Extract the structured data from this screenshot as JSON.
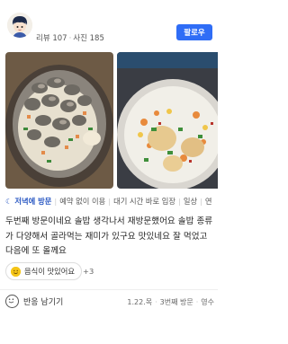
{
  "profile": {
    "stats_reviews": "리뷰 107",
    "stats_photos": "사진 185",
    "follow_label": "팔로우"
  },
  "tags": {
    "lead": "저녁에 방문",
    "items": [
      "예약 없이 이용",
      "대기 시간 바로 입장",
      "일상",
      "연"
    ]
  },
  "review_text": "두번째 방문이네요  솔밥 생각나서 재방문했어요  솔밥 종류가 다양해서 골라먹는 재미가 있구요 맛있네요  잘 먹었고 다음에 또 올께요",
  "keyword_chip": {
    "label": "음식이 맛있어요",
    "more": "+3"
  },
  "reaction_label": "반응 남기기",
  "meta": {
    "date": "1.22.목",
    "visit": "3번째 방문",
    "receipt": "영수"
  },
  "colors": {
    "accent": "#2f6df6",
    "tag_lead": "#2b59c3"
  }
}
